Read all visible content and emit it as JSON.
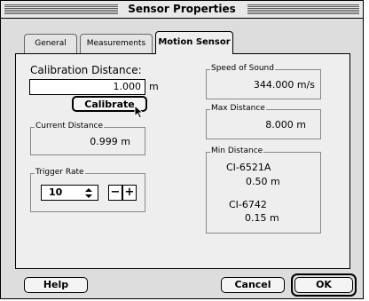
{
  "window": {
    "title": "Sensor Properties"
  },
  "tabs": [
    {
      "label": "General",
      "active": false
    },
    {
      "label": "Measurements",
      "active": false
    },
    {
      "label": "Motion Sensor",
      "active": true
    }
  ],
  "calibration": {
    "label": "Calibration Distance:",
    "value": "1.000",
    "unit": "m",
    "button_label": "Calibrate"
  },
  "current_distance": {
    "label": "Current Distance",
    "value": "0.999 m"
  },
  "trigger_rate": {
    "label": "Trigger Rate",
    "selected": "10",
    "minus": "−",
    "plus": "+"
  },
  "speed_of_sound": {
    "label": "Speed of Sound",
    "value": "344.000 m/s"
  },
  "max_distance": {
    "label": "Max Distance",
    "value": "8.000 m"
  },
  "min_distance": {
    "label": "Min Distance",
    "items": [
      {
        "model": "CI-6521A",
        "value": "0.50 m"
      },
      {
        "model": "CI-6742",
        "value": "0.15 m"
      }
    ]
  },
  "footer": {
    "help_label": "Help",
    "cancel_label": "Cancel",
    "ok_label": "OK"
  }
}
